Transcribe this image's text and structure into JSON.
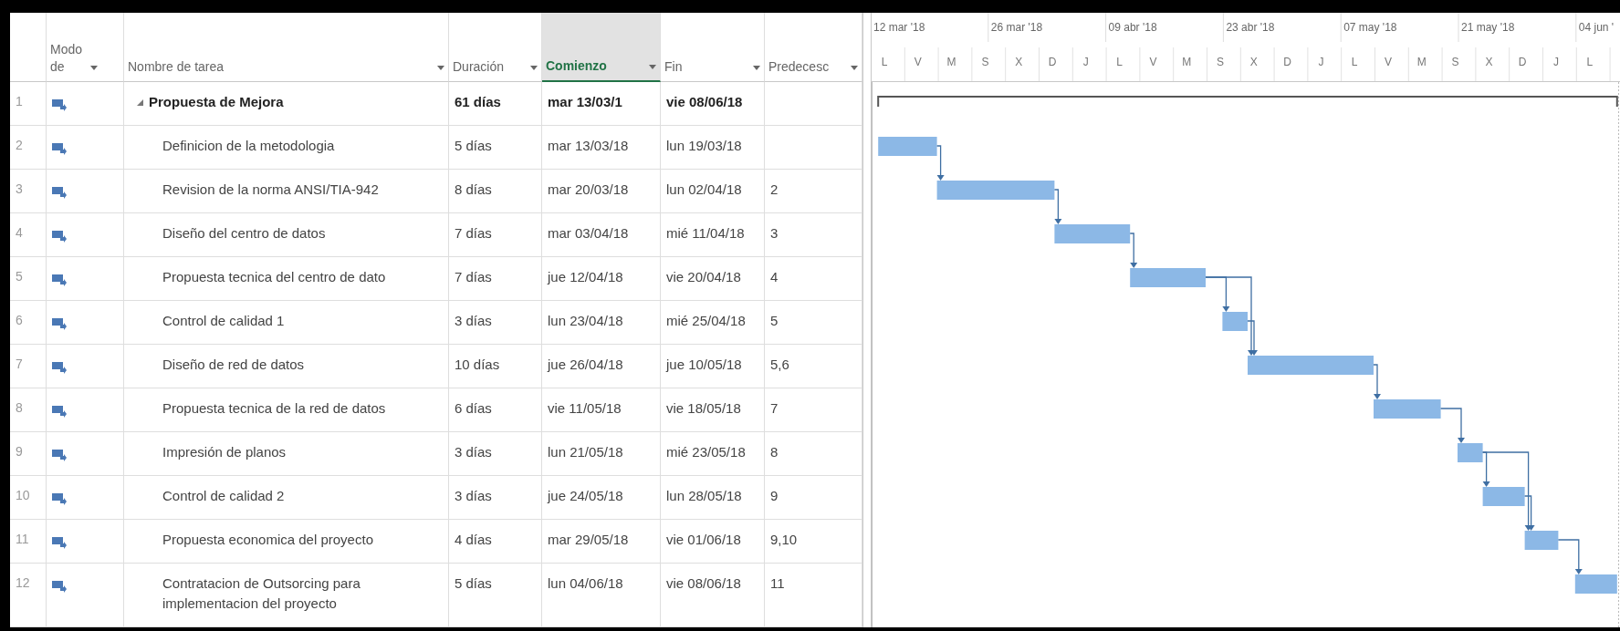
{
  "columns": [
    {
      "label": "Modo de",
      "selected": false
    },
    {
      "label": "Nombre de tarea",
      "selected": false
    },
    {
      "label": "Duración",
      "selected": false
    },
    {
      "label": "Comienzo",
      "selected": true
    },
    {
      "label": "Fin",
      "selected": false
    },
    {
      "label": "Predecesc",
      "selected": false
    }
  ],
  "timescale": {
    "major": [
      "12 mar '18",
      "26 mar '18",
      "09 abr '18",
      "23 abr '18",
      "07 may '18",
      "21 may '18",
      "04 jun '"
    ],
    "minor": [
      "L",
      "V",
      "M",
      "S",
      "X",
      "D",
      "J",
      "L",
      "V",
      "M",
      "S",
      "X",
      "D",
      "J",
      "L",
      "V",
      "M",
      "S",
      "X",
      "D",
      "J",
      "L"
    ]
  },
  "tasks": [
    {
      "id": "1",
      "name": "Propuesta de Mejora",
      "duration": "61 días",
      "start": "mar 13/03/1",
      "finish": "vie 08/06/18",
      "expanded": true,
      "children": [
        {
          "id": "2",
          "name": "Definicion de la metodologia",
          "duration": "5 días",
          "start": "mar 13/03/18",
          "finish": "lun 19/03/18"
        },
        {
          "id": "3",
          "name": "Revision de la norma ANSI/TIA-942",
          "duration": "8 días",
          "start": "mar 20/03/18",
          "finish": "lun 02/04/18",
          "predecessors": "2"
        },
        {
          "id": "4",
          "name": "Diseño del centro de datos",
          "duration": "7 días",
          "start": "mar 03/04/18",
          "finish": "mié 11/04/18",
          "predecessors": "3"
        },
        {
          "id": "5",
          "name": "Propuesta tecnica del centro de dato",
          "duration": "7 días",
          "start": "jue 12/04/18",
          "finish": "vie 20/04/18",
          "predecessors": "4"
        },
        {
          "id": "6",
          "name": "Control de calidad 1",
          "duration": "3 días",
          "start": "lun 23/04/18",
          "finish": "mié 25/04/18",
          "predecessors": "5"
        },
        {
          "id": "7",
          "name": "Diseño de red de datos",
          "duration": "10 días",
          "start": "jue 26/04/18",
          "finish": "jue 10/05/18",
          "predecessors": "5,6"
        },
        {
          "id": "8",
          "name": "Propuesta tecnica de la red de datos",
          "duration": "6 días",
          "start": "vie 11/05/18",
          "finish": "vie 18/05/18",
          "predecessors": "7"
        },
        {
          "id": "9",
          "name": "Impresión de planos",
          "duration": "3 días",
          "start": "lun 21/05/18",
          "finish": "mié 23/05/18",
          "predecessors": "8"
        },
        {
          "id": "10",
          "name": "Control de calidad 2",
          "duration": "3 días",
          "start": "jue 24/05/18",
          "finish": "lun 28/05/18",
          "predecessors": "9"
        },
        {
          "id": "11",
          "name": "Propuesta economica del proyecto",
          "duration": "4 días",
          "start": "mar 29/05/18",
          "finish": "vie 01/06/18",
          "predecessors": "9,10"
        },
        {
          "id": "12",
          "name": "Contratacion de Outsorcing para implementacion del proyecto",
          "duration": "5 días",
          "start": "lun 04/06/18",
          "finish": "vie 08/06/18",
          "predecessors": "11"
        }
      ]
    }
  ]
}
